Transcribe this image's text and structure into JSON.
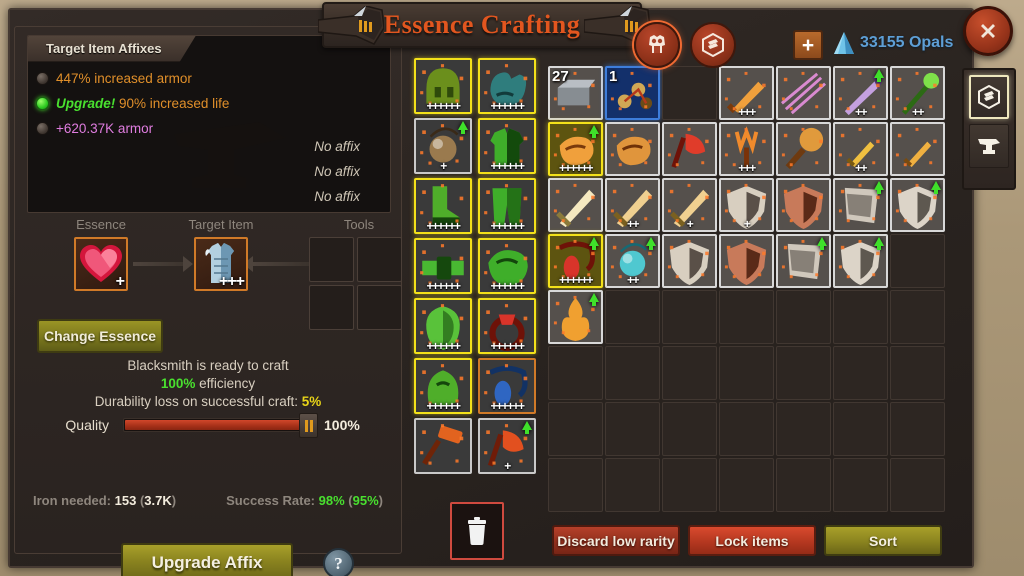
{
  "header": {
    "title": "Essence Crafting",
    "tabs": [
      {
        "name": "armor-tab",
        "icon": "armor-icon",
        "active": true
      },
      {
        "name": "cube-tab",
        "icon": "hexagon-cube-icon",
        "active": false
      }
    ],
    "add_button_label": "+",
    "currency": {
      "icon": "opal-gem-icon",
      "amount": "33155",
      "label": "33155 Opals"
    },
    "close_label": "✕"
  },
  "right_rail": {
    "items": [
      {
        "name": "rail-cube-button",
        "icon": "hexagon-cube-icon",
        "active": true
      },
      {
        "name": "rail-anvil-button",
        "icon": "anvil-icon",
        "active": false
      }
    ]
  },
  "affix_panel": {
    "tab_title": "Target Item Affixes",
    "affixes": [
      {
        "text": "447% increased armor",
        "selected": false,
        "color": "#e08f2a",
        "upgrade_prefix": ""
      },
      {
        "text": "90% increased life",
        "selected": true,
        "color": "#e08f2a",
        "upgrade_prefix": "Upgrade!"
      },
      {
        "text": "+620.37K armor",
        "selected": false,
        "color": "#e07de0",
        "upgrade_prefix": ""
      }
    ],
    "empty_slots": [
      "No affix",
      "No affix",
      "No affix"
    ]
  },
  "craft": {
    "essence_label": "Essence",
    "target_label": "Target Item",
    "tools_label": "Tools",
    "essence_item": {
      "icon": "heart-gem-icon",
      "rank": "+"
    },
    "target_item": {
      "icon": "chest-armor-icon",
      "rank": "+++"
    },
    "tool_slots": 4,
    "change_essence_label": "Change Essence",
    "status_line": "Blacksmith is ready to craft",
    "efficiency_value": "100%",
    "efficiency_label": "efficiency",
    "durability_label": "Durability loss on successful craft:",
    "durability_value": "5%",
    "quality_label": "Quality",
    "quality_percent": "100%",
    "quality_fill": 100,
    "iron_label": "Iron needed:",
    "iron_value": "153",
    "iron_total": "3.7K",
    "success_label": "Success Rate:",
    "success_value": "98%",
    "success_alt": "95%",
    "upgrade_button_label": "Upgrade Affix",
    "help_button_label": "?"
  },
  "essence_list": [
    {
      "rarity": "gold",
      "rank": "++++++",
      "upgrade": false,
      "c1": "#6b8f1c",
      "c2": "#2f4a0b",
      "shape": "helm"
    },
    {
      "rarity": "gold",
      "rank": "++++++",
      "upgrade": false,
      "c1": "#2f7d7d",
      "c2": "#123b3b",
      "shape": "glove"
    },
    {
      "rarity": "gray",
      "rank": "+",
      "upgrade": true,
      "c1": "#9a7a4e",
      "c2": "#3a2a18",
      "shape": "orb"
    },
    {
      "rarity": "gold",
      "rank": "++++++",
      "upgrade": false,
      "c1": "#3fae2a",
      "c2": "#134a0c",
      "shape": "chest"
    },
    {
      "rarity": "gold",
      "rank": "++++++",
      "upgrade": false,
      "c1": "#4fae2a",
      "c2": "#16470c",
      "shape": "boot"
    },
    {
      "rarity": "gold",
      "rank": "++++++",
      "upgrade": false,
      "c1": "#3fae2a",
      "c2": "#134a0c",
      "shape": "pants"
    },
    {
      "rarity": "gold",
      "rank": "++++++",
      "upgrade": false,
      "c1": "#49b832",
      "c2": "#15480d",
      "shape": "belt"
    },
    {
      "rarity": "gold",
      "rank": "++++++",
      "upgrade": false,
      "c1": "#3fae2a",
      "c2": "#13460c",
      "shape": "shoulder"
    },
    {
      "rarity": "gold",
      "rank": "++++++",
      "upgrade": false,
      "c1": "#59c23a",
      "c2": "#1b5010",
      "shape": "cloak"
    },
    {
      "rarity": "gold",
      "rank": "++++++",
      "upgrade": false,
      "c1": "#d8342a",
      "c2": "#6e1208",
      "shape": "ring"
    },
    {
      "rarity": "gold",
      "rank": "++++++",
      "upgrade": false,
      "c1": "#4fae2a",
      "c2": "#14470c",
      "shape": "hood"
    },
    {
      "rarity": "orange",
      "rank": "++++++",
      "upgrade": false,
      "c1": "#2f66c2",
      "c2": "#123264",
      "shape": "amulet"
    },
    {
      "rarity": "gray",
      "rank": "",
      "upgrade": false,
      "c1": "#e2631f",
      "c2": "#6e2408",
      "shape": "hammer"
    },
    {
      "rarity": "gray",
      "rank": "+",
      "upgrade": true,
      "c1": "#e2501f",
      "c2": "#701c08",
      "shape": "axe"
    }
  ],
  "inventory": {
    "rows": [
      [
        {
          "state": "filled",
          "count": "27",
          "rank": "",
          "upgrade": false,
          "c1": "#b9bec4",
          "c2": "#5e6469",
          "shape": "ingot"
        },
        {
          "state": "blue",
          "count": "1",
          "rank": "",
          "upgrade": false,
          "c1": "#d0a855",
          "c2": "#6b4c18",
          "shape": "bolas"
        },
        {
          "state": "empty"
        },
        {
          "state": "filled",
          "count": "",
          "rank": "+++",
          "upgrade": false,
          "c1": "#f0a03c",
          "c2": "#7a3a0c",
          "shape": "sword"
        },
        {
          "state": "filled",
          "count": "",
          "rank": "",
          "upgrade": false,
          "c1": "#d98ad0",
          "c2": "#6a2a60",
          "shape": "arrows"
        },
        {
          "state": "filled",
          "count": "",
          "rank": "++",
          "upgrade": true,
          "c1": "#c4a0e0",
          "c2": "#5a3a78",
          "shape": "spear"
        },
        {
          "state": "filled",
          "count": "",
          "rank": "++",
          "upgrade": false,
          "c1": "#7fe04a",
          "c2": "#2c6a14",
          "shape": "staff"
        }
      ],
      [
        {
          "state": "gold",
          "count": "",
          "rank": "++++++",
          "upgrade": true,
          "c1": "#f0a03c",
          "c2": "#7a3a0c",
          "shape": "gauntlet"
        },
        {
          "state": "filled",
          "count": "",
          "rank": "",
          "upgrade": false,
          "c1": "#e0953c",
          "c2": "#6e3108",
          "shape": "gauntlet"
        },
        {
          "state": "filled",
          "count": "",
          "rank": "",
          "upgrade": false,
          "c1": "#e03c2a",
          "c2": "#6e1208",
          "shape": "axe"
        },
        {
          "state": "filled",
          "count": "",
          "rank": "+++",
          "upgrade": false,
          "c1": "#f08a2c",
          "c2": "#7a3208",
          "shape": "trident"
        },
        {
          "state": "filled",
          "count": "",
          "rank": "",
          "upgrade": false,
          "c1": "#e09a3c",
          "c2": "#6e3a10",
          "shape": "mace"
        },
        {
          "state": "filled",
          "count": "",
          "rank": "++",
          "upgrade": false,
          "c1": "#f0c040",
          "c2": "#7a5a10",
          "shape": "dagger"
        },
        {
          "state": "filled",
          "count": "",
          "rank": "",
          "upgrade": false,
          "c1": "#f0b040",
          "c2": "#7a4a10",
          "shape": "dagger"
        }
      ],
      [
        {
          "state": "filled",
          "count": "",
          "rank": "",
          "upgrade": false,
          "c1": "#f5e9c0",
          "c2": "#8a7a3a",
          "shape": "greatsword"
        },
        {
          "state": "filled",
          "count": "",
          "rank": "++",
          "upgrade": false,
          "c1": "#f0d090",
          "c2": "#7a6020",
          "shape": "greatsword"
        },
        {
          "state": "filled",
          "count": "",
          "rank": "+",
          "upgrade": false,
          "c1": "#f0d090",
          "c2": "#7a6020",
          "shape": "greatsword"
        },
        {
          "state": "filled",
          "count": "",
          "rank": "+",
          "upgrade": false,
          "c1": "#d8cfc0",
          "c2": "#5a5048",
          "shape": "shield"
        },
        {
          "state": "filled",
          "count": "",
          "rank": "",
          "upgrade": false,
          "c1": "#c87a5a",
          "c2": "#5a2a18",
          "shape": "shield"
        },
        {
          "state": "filled",
          "count": "",
          "rank": "",
          "upgrade": true,
          "c1": "#d0c8bc",
          "c2": "#56504a",
          "shape": "buckler"
        },
        {
          "state": "filled",
          "count": "",
          "rank": "",
          "upgrade": true,
          "c1": "#dcd4c8",
          "c2": "#5e5850",
          "shape": "shield"
        }
      ],
      [
        {
          "state": "gold",
          "count": "",
          "rank": "++++++",
          "upgrade": true,
          "c1": "#d8342a",
          "c2": "#6e1208",
          "shape": "amulet"
        },
        {
          "state": "filled",
          "count": "",
          "rank": "++",
          "upgrade": true,
          "c1": "#4fc8d0",
          "c2": "#166a74",
          "shape": "orb"
        },
        {
          "state": "filled",
          "count": "",
          "rank": "",
          "upgrade": false,
          "c1": "#d8cfc0",
          "c2": "#5a5048",
          "shape": "shield"
        },
        {
          "state": "filled",
          "count": "",
          "rank": "",
          "upgrade": false,
          "c1": "#c87a5a",
          "c2": "#5a2a18",
          "shape": "shield"
        },
        {
          "state": "filled",
          "count": "",
          "rank": "",
          "upgrade": true,
          "c1": "#d0c8bc",
          "c2": "#56504a",
          "shape": "buckler"
        },
        {
          "state": "filled",
          "count": "",
          "rank": "",
          "upgrade": true,
          "c1": "#dcd4c8",
          "c2": "#5e5850",
          "shape": "shield"
        },
        {
          "state": "empty"
        }
      ],
      [
        {
          "state": "filled",
          "count": "",
          "rank": "",
          "upgrade": true,
          "c1": "#f0a030",
          "c2": "#7a3a08",
          "shape": "flame"
        },
        {
          "state": "empty"
        },
        {
          "state": "empty"
        },
        {
          "state": "empty"
        },
        {
          "state": "empty"
        },
        {
          "state": "empty"
        },
        {
          "state": "empty"
        }
      ],
      [
        {
          "state": "empty"
        },
        {
          "state": "empty"
        },
        {
          "state": "empty"
        },
        {
          "state": "empty"
        },
        {
          "state": "empty"
        },
        {
          "state": "empty"
        },
        {
          "state": "empty"
        }
      ],
      [
        {
          "state": "empty"
        },
        {
          "state": "empty"
        },
        {
          "state": "empty"
        },
        {
          "state": "empty"
        },
        {
          "state": "empty"
        },
        {
          "state": "empty"
        },
        {
          "state": "empty"
        }
      ],
      [
        {
          "state": "empty"
        },
        {
          "state": "empty"
        },
        {
          "state": "empty"
        },
        {
          "state": "empty"
        },
        {
          "state": "empty"
        },
        {
          "state": "empty"
        },
        {
          "state": "empty"
        }
      ]
    ],
    "buttons": [
      {
        "name": "discard-low-rarity-button",
        "label": "Discard low rarity",
        "style": "discard"
      },
      {
        "name": "lock-items-button",
        "label": "Lock items",
        "style": "lock"
      },
      {
        "name": "sort-button",
        "label": "Sort",
        "style": "sort"
      }
    ],
    "trash_icon": "trash-can-icon"
  }
}
